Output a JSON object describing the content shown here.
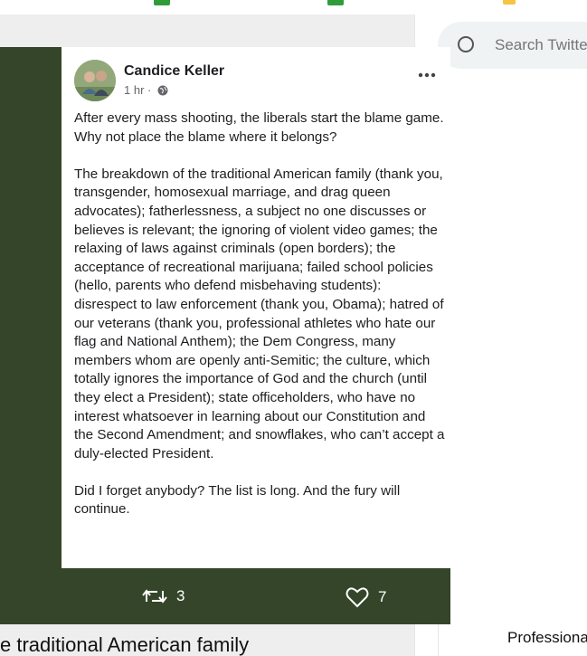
{
  "search": {
    "placeholder": "Search Twitter"
  },
  "post": {
    "author": "Candice Keller",
    "meta": "1 hr ·",
    "paragraphs": [
      "After every mass shooting, the liberals start the blame game. Why not place the blame where it belongs?",
      "The breakdown of the traditional American family (thank you, transgender, homosexual marriage, and drag queen advocates); fatherlessness, a subject no one discusses or believes is relevant; the ignoring of violent video games; the relaxing of laws against criminals (open borders); the acceptance of recreational marijuana; failed school policies (hello, parents who defend misbehaving students): disrespect to law enforcement (thank you, Obama); hatred of our veterans (thank you, professional athletes who hate our flag and National Anthem); the Dem Congress, many members whom are openly anti-Semitic; the culture, which totally ignores the importance of God and the church (until they elect a President); state officeholders, who have no interest whatsoever in learning about our Constitution and the Second Amendment; and snowflakes, who can’t accept a duly-elected President.",
      "Did I forget anybody? The list is long. And the fury will continue."
    ]
  },
  "actions": {
    "retweets": "3",
    "likes": "7"
  },
  "below": {
    "left_text": "e traditional American family",
    "right_text": "Professiona"
  },
  "colors": {
    "media_bg": "#35452a"
  }
}
